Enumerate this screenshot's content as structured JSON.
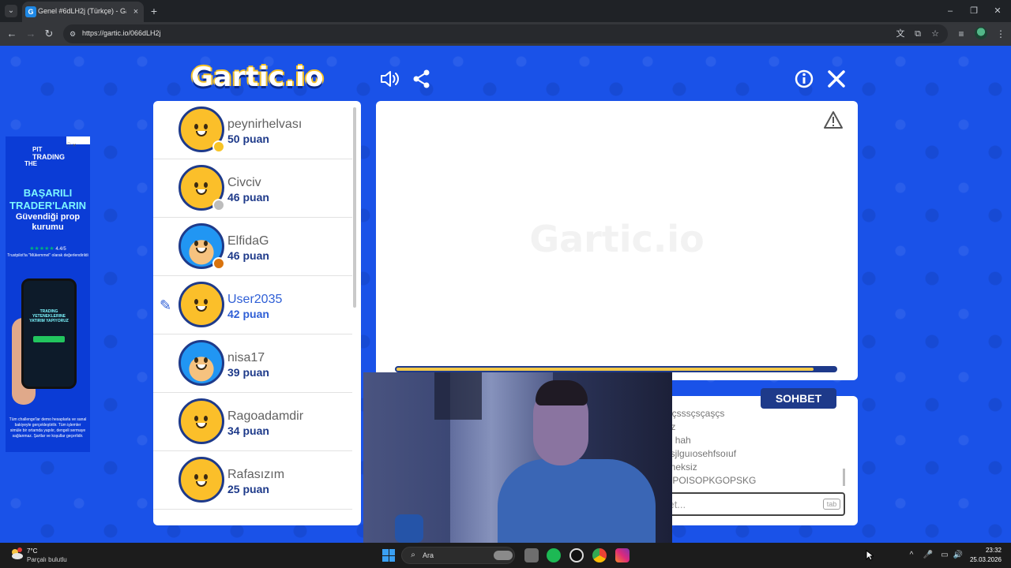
{
  "browser": {
    "tab_title": "Genel #6dLH2j (Türkçe) - Gartic",
    "tab_favicon": "G",
    "url": "https://gartic.io/066dLH2j",
    "icons": {
      "tab_list": "chevron-down-icon",
      "close": "×",
      "new_tab": "+",
      "minimize": "–",
      "restore": "❐",
      "win_close": "✕",
      "back": "←",
      "forward": "→",
      "reload": "↻",
      "site_info": "⚙",
      "translate": "文",
      "install": "⧉",
      "bookmark": "☆",
      "media": "≡",
      "menu": "⋮"
    }
  },
  "game": {
    "logo": "Gartic.io",
    "watermark": "Gartic.io",
    "icons": {
      "sound": "🔈",
      "share": "⋖",
      "info": "ⓘ",
      "close": "✕",
      "pencil": "✎"
    },
    "timer_fraction": 0.95,
    "players": [
      {
        "name": "peynirhelvası",
        "score": "50 puan",
        "badge_color": "#f7c325",
        "avatar": "smiley"
      },
      {
        "name": "Civciv",
        "score": "46 puan",
        "badge_color": "#bdbdbd",
        "avatar": "smiley"
      },
      {
        "name": "ElfidaG",
        "score": "46 puan",
        "badge_color": "#d9730d",
        "avatar": "girl"
      },
      {
        "name": "User2035",
        "score": "42 puan",
        "badge_color": "",
        "avatar": "smiley",
        "drawing": true
      },
      {
        "name": "nisa17",
        "score": "39 puan",
        "badge_color": "",
        "avatar": "girl"
      },
      {
        "name": "Ragoadamdir",
        "score": "34 puan",
        "badge_color": "",
        "avatar": "smiley"
      },
      {
        "name": "Rafasızım",
        "score": "25 puan",
        "badge_color": "",
        "avatar": "smiley"
      }
    ],
    "chat": {
      "tab_label": "SOHBET",
      "messages": [
        "dsçsçsssçsçaşçs",
        "çerez",
        "lipop hah",
        "go ksjlguıosehfsoıuf",
        "yeteneksiz",
        "PSGPOISOPKGOPSKG"
      ],
      "placeholder": "bbet...",
      "tab_hint": "tab"
    }
  },
  "ad": {
    "close_label": "ⓘ ✕",
    "pit": "PIT",
    "trading": "TRADING",
    "the": "THE",
    "headline": "BAŞARILI TRADER'LARIN",
    "subheadline": "Güvendiği prop kurumu",
    "rating": "4.4/5",
    "stars": "★★★★★",
    "trustpilot": "Trustpilot'ta \"Mükemmel\" olarak değerlendirildi",
    "phone_title": "TRADING YETENEKLERINE YATIRIM YAPIYORUZ",
    "footer": "Tüm challenge'lar demo hesaplarla ve sanal bakiyeyle gerçekleştirilir. Tüm işlemler simüle bir ortamda yapılır, dengeli sermaye sağlanmaz. Şartlar ve koşullar geçerlidir."
  },
  "taskbar": {
    "temperature": "7°C",
    "weather": "Parçalı bulutlu",
    "search_label": "Ara",
    "time": "23:32",
    "date": "25.03.2026",
    "tray_icons": {
      "chevron": "^",
      "mic": "🎤",
      "display": "▭",
      "volume": "🔊"
    }
  }
}
